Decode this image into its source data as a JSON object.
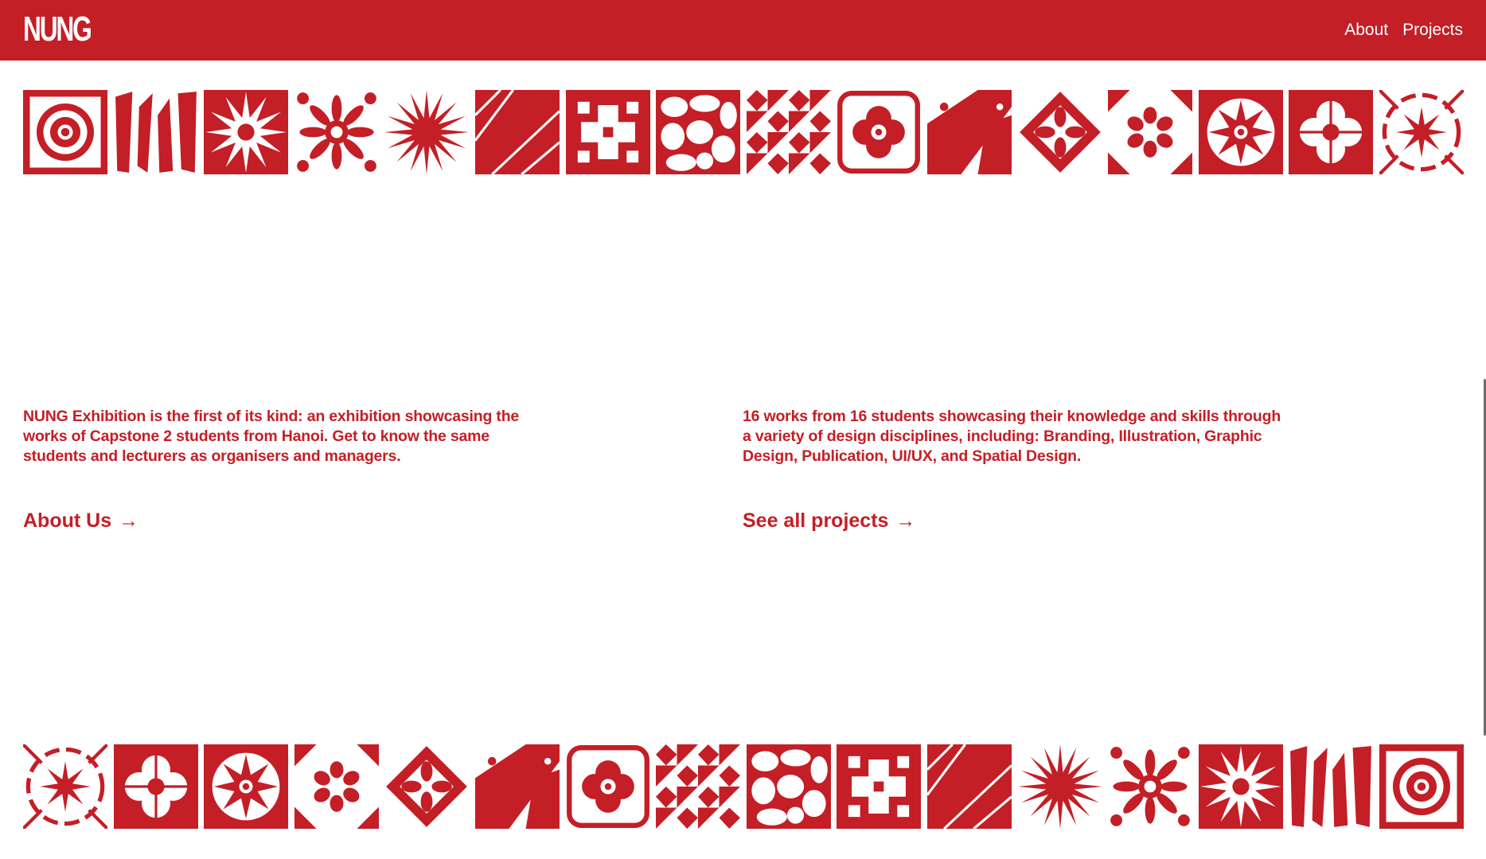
{
  "header": {
    "logo": "NUNG",
    "nav": [
      {
        "label": "About"
      },
      {
        "label": "Projects"
      }
    ]
  },
  "colors": {
    "brand_red": "#c41e26",
    "background": "#ffffff"
  },
  "tiles_top": [
    "concentric-square-tile",
    "brushstroke-tile",
    "starburst-tile",
    "floral-ornament-tile",
    "spiky-star-tile",
    "geometric-shards-tile",
    "cross-cutout-tile",
    "pebble-mosaic-tile",
    "checker-diamond-tile",
    "quatrefoil-stamp-tile",
    "splatter-tile",
    "diamond-ornament-tile",
    "flower-corner-tile",
    "star-medallion-tile",
    "quatrefoil-tile",
    "ring-burst-tile"
  ],
  "tiles_bottom": [
    "ring-burst-tile",
    "quatrefoil-tile",
    "star-medallion-tile",
    "flower-corner-tile",
    "diamond-ornament-tile",
    "splatter-tile",
    "quatrefoil-stamp-tile",
    "checker-diamond-tile",
    "pebble-mosaic-tile",
    "cross-cutout-tile",
    "geometric-shards-tile",
    "spiky-star-tile",
    "floral-ornament-tile",
    "starburst-tile",
    "brushstroke-tile",
    "concentric-square-tile"
  ],
  "intro": {
    "left_text": "NUNG Exhibition is the first of its kind: an exhibition showcasing the works of Capstone 2 students from Hanoi. Get to know the same students and lecturers as organisers and managers.",
    "left_link": "About Us",
    "right_text": "16 works from 16 students showcasing their knowledge and skills through a variety of design disciplines, including: Branding, Illustration, Graphic Design, Publication, UI/UX, and Spatial Design.",
    "right_link": "See all projects",
    "arrow": "→"
  }
}
